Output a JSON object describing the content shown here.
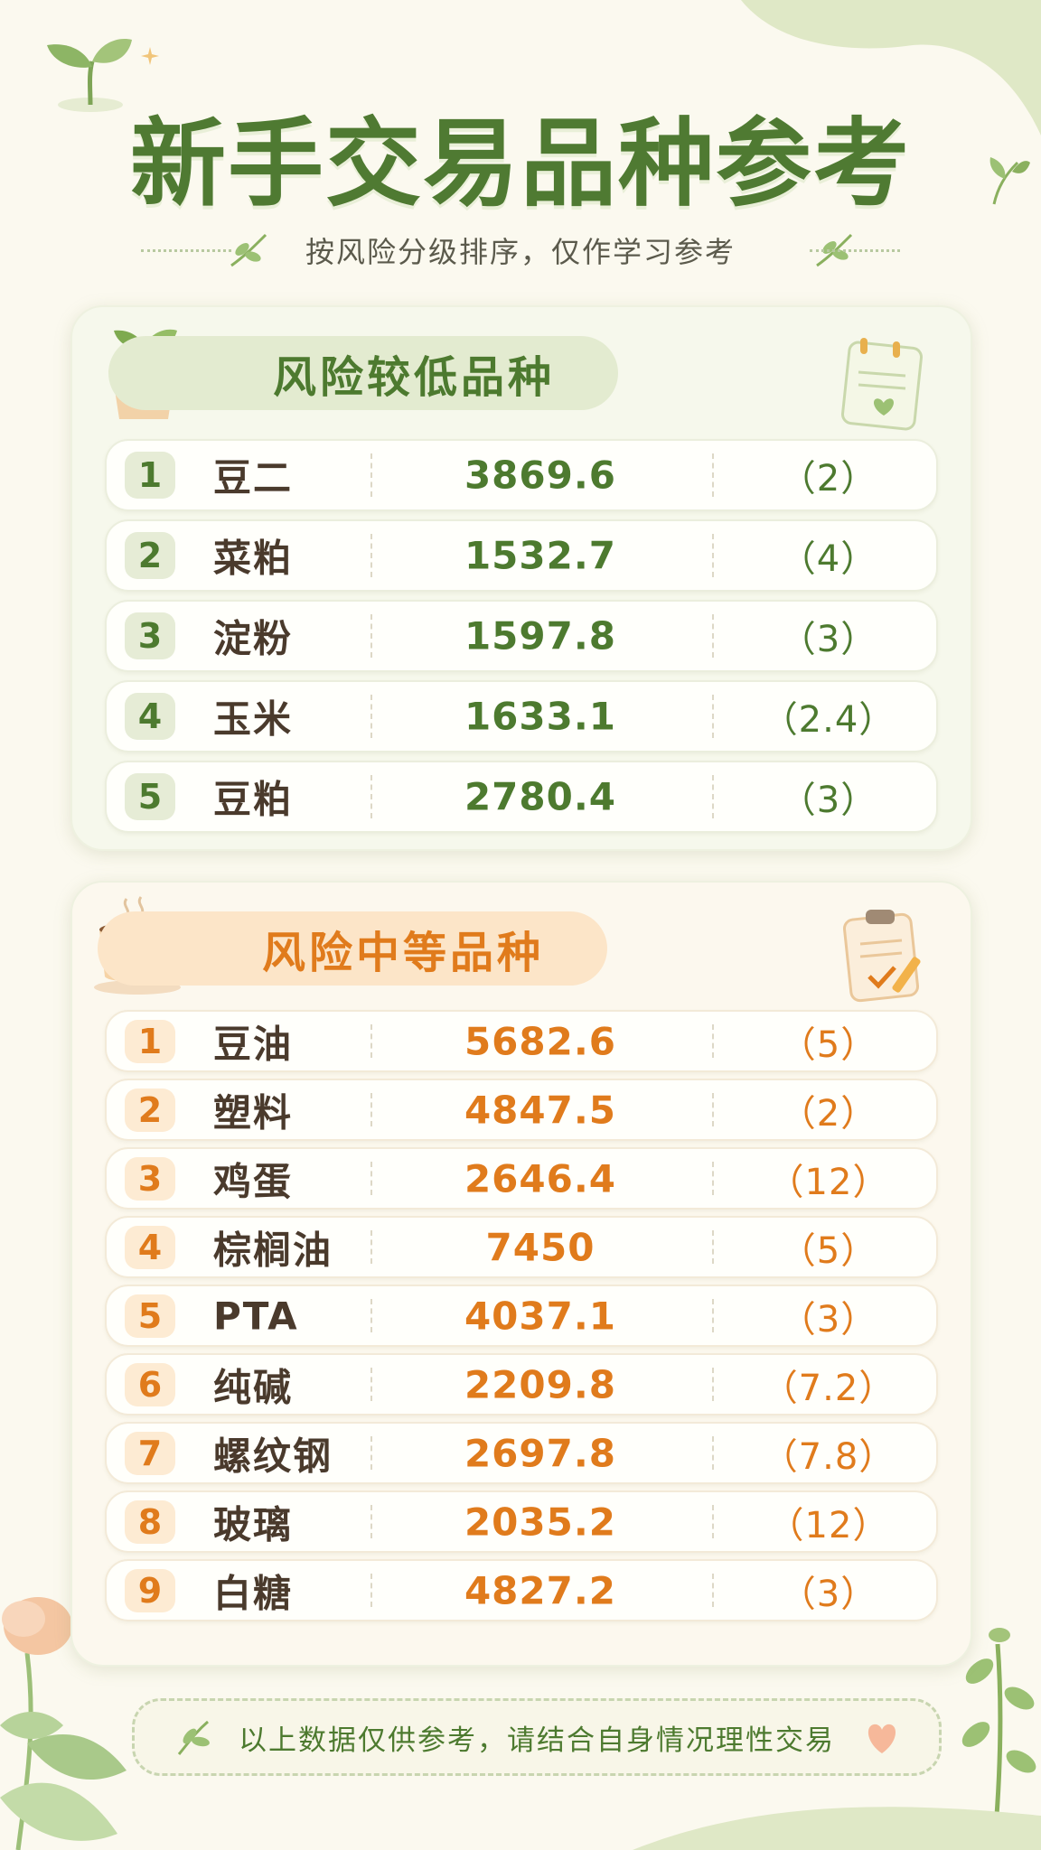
{
  "title": "新手交易品种参考",
  "subtitle": "按风险分级排序，仅作学习参考",
  "low_risk": {
    "heading": "风险较低品种",
    "items": [
      {
        "rank": "1",
        "name": "豆二",
        "value": "3869.6",
        "ratio": "（2）"
      },
      {
        "rank": "2",
        "name": "菜粕",
        "value": "1532.7",
        "ratio": "（4）"
      },
      {
        "rank": "3",
        "name": "淀粉",
        "value": "1597.8",
        "ratio": "（3）"
      },
      {
        "rank": "4",
        "name": "玉米",
        "value": "1633.1",
        "ratio": "（2.4）"
      },
      {
        "rank": "5",
        "name": "豆粕",
        "value": "2780.4",
        "ratio": "（3）"
      }
    ]
  },
  "mid_risk": {
    "heading": "风险中等品种",
    "items": [
      {
        "rank": "1",
        "name": "豆油",
        "value": "5682.6",
        "ratio": "（5）"
      },
      {
        "rank": "2",
        "name": "塑料",
        "value": "4847.5",
        "ratio": "（2）"
      },
      {
        "rank": "3",
        "name": "鸡蛋",
        "value": "2646.4",
        "ratio": "（12）"
      },
      {
        "rank": "4",
        "name": "棕榈油",
        "value": "7450",
        "ratio": "（5）"
      },
      {
        "rank": "5",
        "name": "PTA",
        "value": "4037.1",
        "ratio": "（3）"
      },
      {
        "rank": "6",
        "name": "纯碱",
        "value": "2209.8",
        "ratio": "（7.2）"
      },
      {
        "rank": "7",
        "name": "螺纹钢",
        "value": "2697.8",
        "ratio": "（7.8）"
      },
      {
        "rank": "8",
        "name": "玻璃",
        "value": "2035.2",
        "ratio": "（12）"
      },
      {
        "rank": "9",
        "name": "白糖",
        "value": "4827.2",
        "ratio": "（3）"
      }
    ]
  },
  "footer": "以上数据仅供参考，请结合自身情况理性交易",
  "colors": {
    "green": "#4d7a2f",
    "orange": "#e07b1c",
    "background": "#fbf9ef"
  }
}
